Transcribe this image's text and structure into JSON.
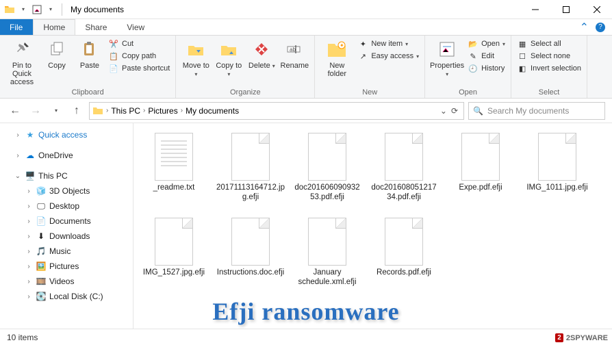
{
  "window": {
    "title": "My documents"
  },
  "tabs": {
    "file": "File",
    "home": "Home",
    "share": "Share",
    "view": "View"
  },
  "ribbon": {
    "clipboard": {
      "label": "Clipboard",
      "pin": "Pin to Quick access",
      "copy": "Copy",
      "paste": "Paste",
      "cut": "Cut",
      "copy_path": "Copy path",
      "paste_shortcut": "Paste shortcut"
    },
    "organize": {
      "label": "Organize",
      "move_to": "Move to",
      "copy_to": "Copy to",
      "delete": "Delete",
      "rename": "Rename"
    },
    "new": {
      "label": "New",
      "new_folder": "New folder",
      "new_item": "New item",
      "easy_access": "Easy access"
    },
    "open": {
      "label": "Open",
      "properties": "Properties",
      "open": "Open",
      "edit": "Edit",
      "history": "History"
    },
    "select": {
      "label": "Select",
      "select_all": "Select all",
      "select_none": "Select none",
      "invert": "Invert selection"
    }
  },
  "breadcrumb": {
    "segments": [
      "This PC",
      "Pictures",
      "My documents"
    ]
  },
  "search": {
    "placeholder": "Search My documents"
  },
  "sidebar": {
    "quick_access": "Quick access",
    "onedrive": "OneDrive",
    "this_pc": "This PC",
    "items": [
      "3D Objects",
      "Desktop",
      "Documents",
      "Downloads",
      "Music",
      "Pictures",
      "Videos",
      "Local Disk (C:)"
    ]
  },
  "files": [
    {
      "name": "_readme.txt",
      "kind": "txt"
    },
    {
      "name": "20171113164712.jpg.efji",
      "kind": "blank"
    },
    {
      "name": "doc201606090932 53.pdf.efji",
      "kind": "blank"
    },
    {
      "name": "doc201608051217 34.pdf.efji",
      "kind": "blank"
    },
    {
      "name": "Expe.pdf.efji",
      "kind": "blank"
    },
    {
      "name": "IMG_1011.jpg.efji",
      "kind": "blank"
    },
    {
      "name": "IMG_1527.jpg.efji",
      "kind": "blank"
    },
    {
      "name": "Instructions.doc.efji",
      "kind": "blank"
    },
    {
      "name": "January schedule.xml.efji",
      "kind": "blank"
    },
    {
      "name": "Records.pdf.efji",
      "kind": "blank"
    }
  ],
  "status": {
    "items": "10 items"
  },
  "watermark": "Efji ransomware",
  "badge": "2SPYWARE"
}
